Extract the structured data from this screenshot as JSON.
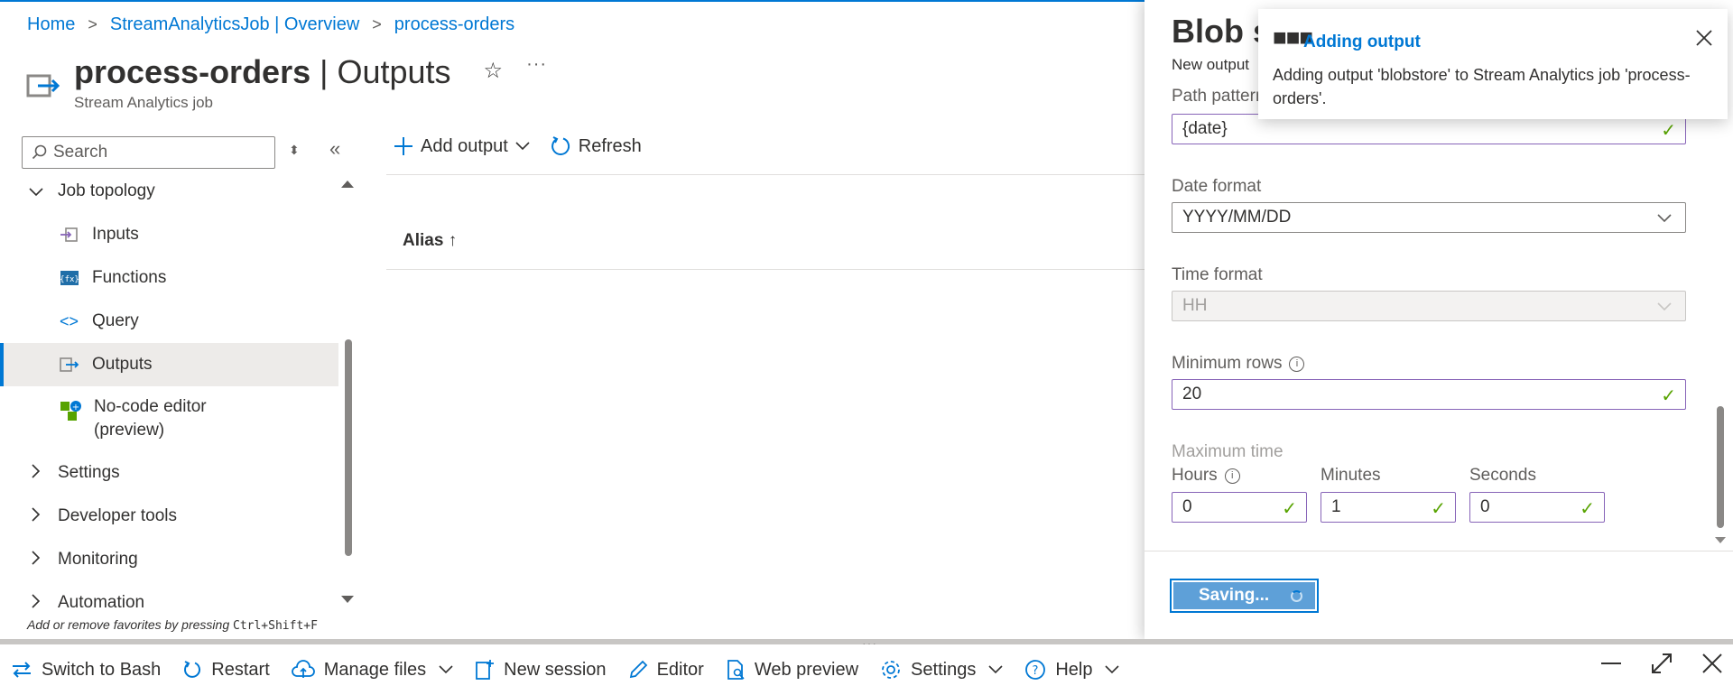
{
  "breadcrumb": {
    "home": "Home",
    "overview": "StreamAnalyticsJob | Overview",
    "current": "process-orders"
  },
  "page": {
    "title_bold": "process-orders",
    "title_rest": " | Outputs",
    "subtitle": "Stream Analytics job",
    "star": "☆",
    "more": "···"
  },
  "sidebar": {
    "search_placeholder": "Search",
    "items": [
      {
        "label": "Job topology",
        "expanded": true
      },
      {
        "label": "Inputs"
      },
      {
        "label": "Functions"
      },
      {
        "label": "Query"
      },
      {
        "label": "Outputs",
        "selected": true
      },
      {
        "label": "No-code editor"
      },
      {
        "label": "(preview)"
      },
      {
        "label": "Settings"
      },
      {
        "label": "Developer tools"
      },
      {
        "label": "Monitoring"
      },
      {
        "label": "Automation"
      }
    ],
    "hint_prefix": "Add or remove favorites by pressing ",
    "hint_keys": "Ctrl+Shift+F"
  },
  "toolbar": {
    "add_output": "Add output",
    "refresh": "Refresh"
  },
  "table": {
    "alias_header": "Alias ↑"
  },
  "panel": {
    "title": "Blob s",
    "subtitle": "New output",
    "path_label": "Path pattern",
    "path_value": "{date}",
    "date_format_label": "Date format",
    "date_format_value": "YYYY/MM/DD",
    "time_format_label": "Time format",
    "time_format_value": "HH",
    "min_rows_label": "Minimum rows",
    "min_rows_value": "20",
    "max_time_label": "Maximum time",
    "hours_label": "Hours",
    "hours_value": "0",
    "minutes_label": "Minutes",
    "minutes_value": "1",
    "seconds_label": "Seconds",
    "seconds_value": "0",
    "saving": "Saving..."
  },
  "toast": {
    "title": "Adding output",
    "message": "Adding output 'blobstore' to Stream Analytics job 'process-orders'."
  },
  "shell": {
    "switch": "Switch to Bash",
    "restart": "Restart",
    "manage": "Manage files",
    "new_session": "New session",
    "editor": "Editor",
    "web_preview": "Web preview",
    "settings": "Settings",
    "help": "Help"
  },
  "colors": {
    "accent": "#0078d4",
    "valid_border": "#8764b8",
    "check": "#57a300"
  }
}
